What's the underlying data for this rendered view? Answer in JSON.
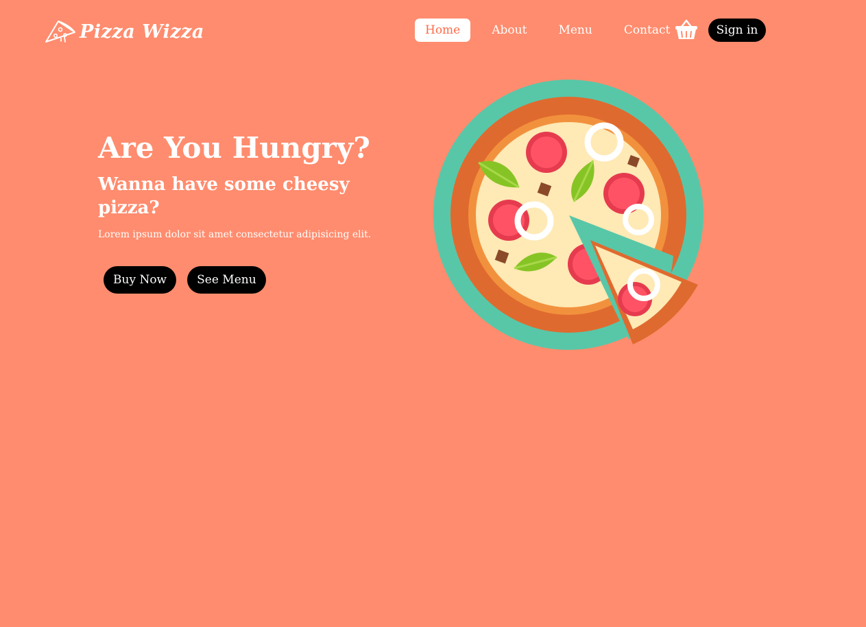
{
  "brand": {
    "name": "Pizza Wizza",
    "icon": "pizza-slice-icon"
  },
  "nav": {
    "links": [
      {
        "label": "Home",
        "active": true
      },
      {
        "label": "About",
        "active": false
      },
      {
        "label": "Menu",
        "active": false
      },
      {
        "label": "Contact",
        "active": false
      }
    ],
    "cart_icon": "basket-icon",
    "signin_label": "Sign in"
  },
  "hero": {
    "title": "Are You Hungry?",
    "subtitle": "Wanna have some cheesy pizza?",
    "description": "Lorem ipsum dolor sit amet consectetur adipisicing elit.",
    "buttons": {
      "buy_now": "Buy Now",
      "see_menu": "See Menu"
    },
    "illustration_icon": "pizza-icon"
  },
  "colors": {
    "background": "#ff8c6e",
    "active_link_text": "#ff6b4a",
    "button_bg": "#000000",
    "text": "#ffffff",
    "plate": "#58c7a8",
    "crust": "#df6a2f",
    "cheese": "#ffe9b5"
  }
}
